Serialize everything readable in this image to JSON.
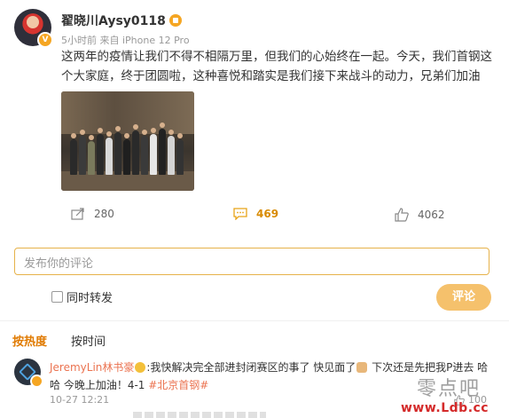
{
  "post": {
    "username": "翟晓川Aysy0118",
    "meta": "5小时前 来自 iPhone 12 Pro",
    "text": "这两年的疫情让我们不得不相隔万里，但我们的心始终在一起。今天，我们首钢这个大家庭，终于团圆啦，这种喜悦和踏实是我们接下来战斗的动力，兄弟们加油",
    "actions": {
      "share_count": "280",
      "comment_count": "469",
      "like_count": "4062"
    }
  },
  "composer": {
    "placeholder": "发布你的评论",
    "repost_label": "同时转发",
    "submit_label": "评论"
  },
  "sort_tabs": {
    "hot": "按热度",
    "time": "按时间"
  },
  "comment": {
    "author": "JeremyLin林书豪",
    "text_1": ":我快解决完全部进封闭赛区的事了 快见面了",
    "text_2": " 下次还是先把我P进去 哈哈 今晚上加油！4-1 ",
    "hashtag": "#北京首钢#",
    "time": "10-27 12:21",
    "like_count": "100"
  },
  "watermark": {
    "cn": "零点吧",
    "url": "www.Ldb.cc"
  },
  "colors": {
    "accent": "#e07a00",
    "link": "#eb7350",
    "border_focus": "#e6b24a",
    "button_disabled": "#f5c16c"
  }
}
